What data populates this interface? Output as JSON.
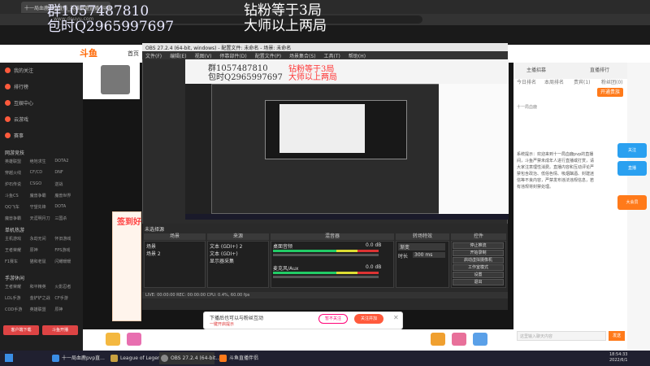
{
  "browser": {
    "tab_title": "十一局血鹿pvp直播_英雄联盟直播_斗鱼",
    "address": "www.douyu.com"
  },
  "overlay": {
    "qun": "群1057487810",
    "baoshi": "包时Q2965997697",
    "zuanfen": "钻粉等于3局",
    "dashi": "大师以上两局"
  },
  "header": {
    "logo": "斗鱼",
    "nav_home": "首页"
  },
  "sidebar": {
    "items": [
      {
        "label": "我的关注"
      },
      {
        "label": "排行榜"
      },
      {
        "label": "互娱中心"
      },
      {
        "label": "云游戏"
      },
      {
        "label": "赛事"
      }
    ],
    "section_game": "网游竞技",
    "game_grid": [
      "英雄联盟",
      "绝地求生",
      "DOTA2",
      "穿越火线",
      "CF/CD",
      "DNF",
      "炉石传说",
      "CSGO",
      "逆战",
      "斗鱼CS",
      "魔兽争霸",
      "魔兽世界",
      "QQ飞车",
      "守望先锋",
      "DOTA",
      "魔兽争霸",
      "天涯明月刀",
      "三国杀"
    ],
    "section_mobile": "单机热游",
    "mobile_grid": [
      "主机游戏",
      "永劫无间",
      "怀旧游戏",
      "王者荣耀",
      "原神",
      "FPS游戏",
      "F1赛车",
      "猫和老鼠",
      "闪耀暖暖"
    ],
    "section_hand": "手游休闲",
    "hand_grid": [
      "王者荣耀",
      "和平精英",
      "火影忍者",
      "LOL手游",
      "金铲铲之战",
      "CF手游",
      "COD手游",
      "英雄联盟",
      "原神"
    ],
    "btn_download": "客户端下载",
    "btn_open": "斗鱼开播"
  },
  "sign_banner": "签到好",
  "obs": {
    "title": "OBS 27.2.4 (64-bit, windows) - 配置文件: 未命名 - 场景: 未命名",
    "menu": [
      "文件(F)",
      "编辑(E)",
      "视图(V)",
      "停靠部件(D)",
      "配置文件(P)",
      "场景集合(S)",
      "工具(T)",
      "帮助(H)"
    ],
    "scenes_label": "未选择源",
    "dock_scenes": "场景",
    "dock_sources": "来源",
    "dock_mixer": "混音器",
    "dock_transitions": "转场特效",
    "dock_controls": "控件",
    "scenes": [
      "场景",
      "场景 2"
    ],
    "sources": [
      "文本 (GDI+) 2",
      "文本 (GDI+)",
      "显示器采集"
    ],
    "mixer": [
      {
        "name": "桌面音频",
        "db": "0.0 dB"
      },
      {
        "name": "麦克风/Aux",
        "db": "0.0 dB"
      }
    ],
    "transition": "渐变",
    "duration_label": "时长",
    "duration_value": "300 ms",
    "controls": [
      "停止推流",
      "开始录制",
      "启动虚拟摄像机",
      "工作室模式",
      "设置",
      "退出"
    ],
    "status": "LIVE: 00:00:00   REC: 00:00:00   CPU: 0.4%, 60.00 fps"
  },
  "right": {
    "tab_host": "主播招募",
    "tab_rank": "直播排行",
    "rank_tabs": [
      "今日排名",
      "本周排名",
      "贵宾(1)",
      "粉丝团(0)"
    ],
    "open_guard": "开通贵族",
    "chat_hint": "十一局血鹿",
    "chat_text": "系统提示：欢迎来到十一局血鹿pvp的直播间，斗鱼严禁未成年人进行直播或打赏，请大家注意理性消费。直播内容和互动评论严禁包含政治、低俗色情、吸烟酗酒、封建迷信等不良内容，严禁发布违法违规信息，若有违规将封禁处理。",
    "chat_placeholder": "这里输入聊天内容",
    "send": "发送",
    "rail": [
      "关注",
      "直播",
      "大会员"
    ]
  },
  "popup": {
    "text": "下播后也可以与粉丝互动",
    "link": "一键开启提示",
    "no_follow": "暂不关注",
    "follow": "关注并加"
  },
  "taskbar": {
    "items": [
      "十一局血鹿pvp直...",
      "League of Legends",
      "OBS 27.2.4 (64-bit...",
      "斗鱼直播伴侣"
    ],
    "time": "18:54:33",
    "date": "2022/6/1"
  }
}
